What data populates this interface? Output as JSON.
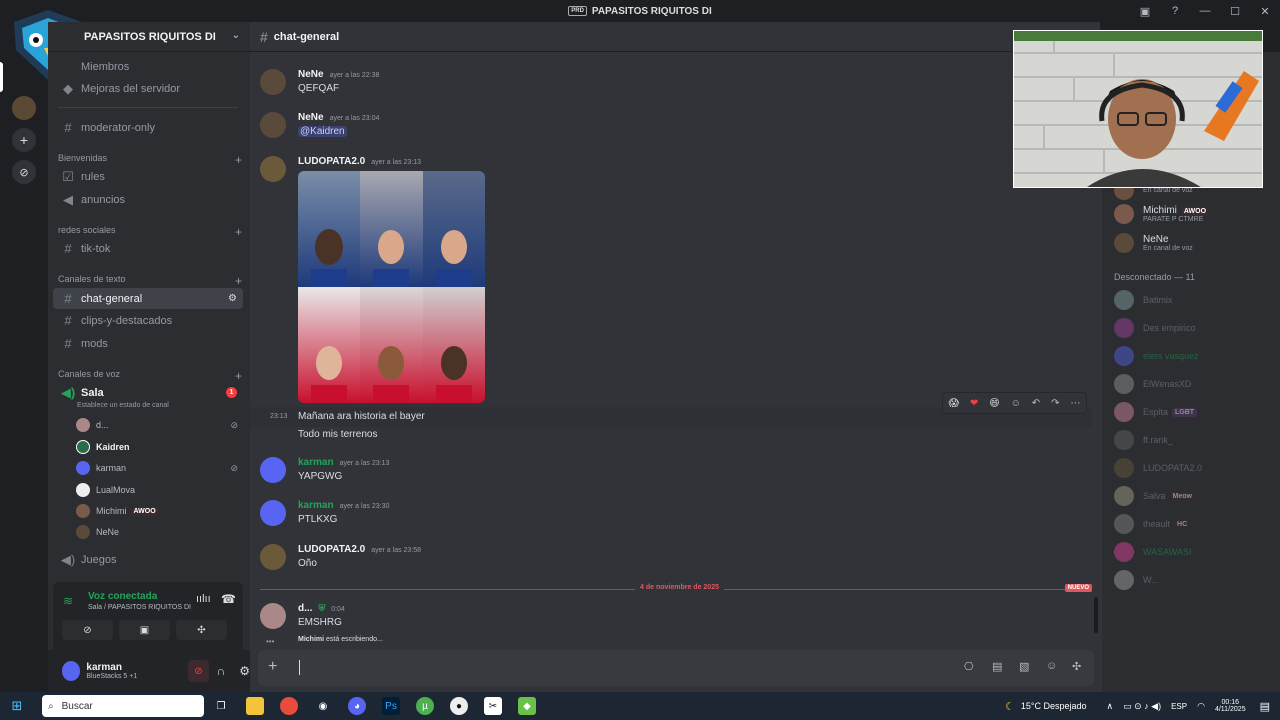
{
  "window": {
    "title": "PAPASITOS RIQUITOS DI",
    "badge": "PRD",
    "minimize": "—",
    "maximize": "☐",
    "close": "✕"
  },
  "server": {
    "name": "PAPASITOS RIQUITOS DI"
  },
  "sidebar": {
    "top_items": [
      {
        "label": "Miembros"
      },
      {
        "label": "Mejoras del servidor"
      }
    ],
    "moderator": "moderator-only",
    "categories": {
      "bienvenidas": "Bienvenidas",
      "redes": "redes sociales",
      "texto": "Canales de texto",
      "voz": "Canales de voz"
    },
    "bienvenidas": [
      "rules",
      "anuncios"
    ],
    "redes": [
      "tik-tok"
    ],
    "texto": [
      "chat-general",
      "clips-y-destacados",
      "mods"
    ],
    "voice_channel": {
      "name": "Sala",
      "badge": "1",
      "status": "Establece un estado de canal"
    },
    "voice_users": [
      {
        "name": "d..."
      },
      {
        "name": "Kaidren"
      },
      {
        "name": "karman"
      },
      {
        "name": "LualMova"
      },
      {
        "name": "Michimi",
        "tag": "AWOO"
      },
      {
        "name": "NeNe"
      }
    ],
    "juegos": "Juegos"
  },
  "voice": {
    "status": "Voz conectada",
    "location": "Sala / PAPASITOS RIQUITOS DI"
  },
  "user": {
    "name": "karman",
    "activity": "BlueStacks 5 +1"
  },
  "channel": {
    "name": "chat-general"
  },
  "messages": [
    {
      "author": "NeNe",
      "time": "ayer a las 22:38",
      "text": "QEFQAF"
    },
    {
      "author": "NeNe",
      "time": "ayer a las 23:04",
      "mention": "@Kaidren"
    },
    {
      "author": "LUDOPATA2.0",
      "time": "ayer a las 23:13",
      "followups": [
        {
          "time": "23:13",
          "text": "Mañana ara historia el bayer"
        },
        {
          "text": "Todo mis terrenos"
        }
      ]
    },
    {
      "author": "karman",
      "time": "ayer a las 23:13",
      "text": "YAPGWG"
    },
    {
      "author": "karman",
      "time": "ayer a las 23:30",
      "text": "PTLKXG"
    },
    {
      "author": "LUDOPATA2.0",
      "time": "ayer a las 23:58",
      "text": "Oño"
    },
    {
      "author": "d...",
      "time": "0:04",
      "text": "EMSHRG"
    }
  ],
  "date_divider": "4 de noviembre de 2025",
  "new_badge": "NUEVO",
  "typing": {
    "user": "Michimi",
    "text": "está escribiendo..."
  },
  "members_online": [
    {
      "name": "",
      "status": "En canal de voz"
    },
    {
      "name": "Michimi",
      "tag": "AWOO",
      "status": "PARATE P CTMRE"
    },
    {
      "name": "NeNe",
      "status": "En canal de voz"
    }
  ],
  "offline_header": "Desconectado — 11",
  "members_offline": [
    {
      "name": "Batimix"
    },
    {
      "name": "Des empirico"
    },
    {
      "name": "elers vasquez"
    },
    {
      "name": "ElWenasXD"
    },
    {
      "name": "Espita",
      "tag": "LGBT"
    },
    {
      "name": "ff.rank_"
    },
    {
      "name": "LUDOPATA2.0"
    },
    {
      "name": "Salva",
      "tag": "Meow"
    },
    {
      "name": "theault",
      "tag": "HC"
    },
    {
      "name": "WASAWASI"
    },
    {
      "name": "W..."
    }
  ],
  "taskbar": {
    "search": "Buscar",
    "weather": "15°C  Despejado",
    "lang": "ESP",
    "time": "00:16",
    "date": "4/11/2025"
  },
  "colors": {
    "accent": "#5865f2",
    "green": "#23a55a",
    "red": "#f23f43"
  }
}
